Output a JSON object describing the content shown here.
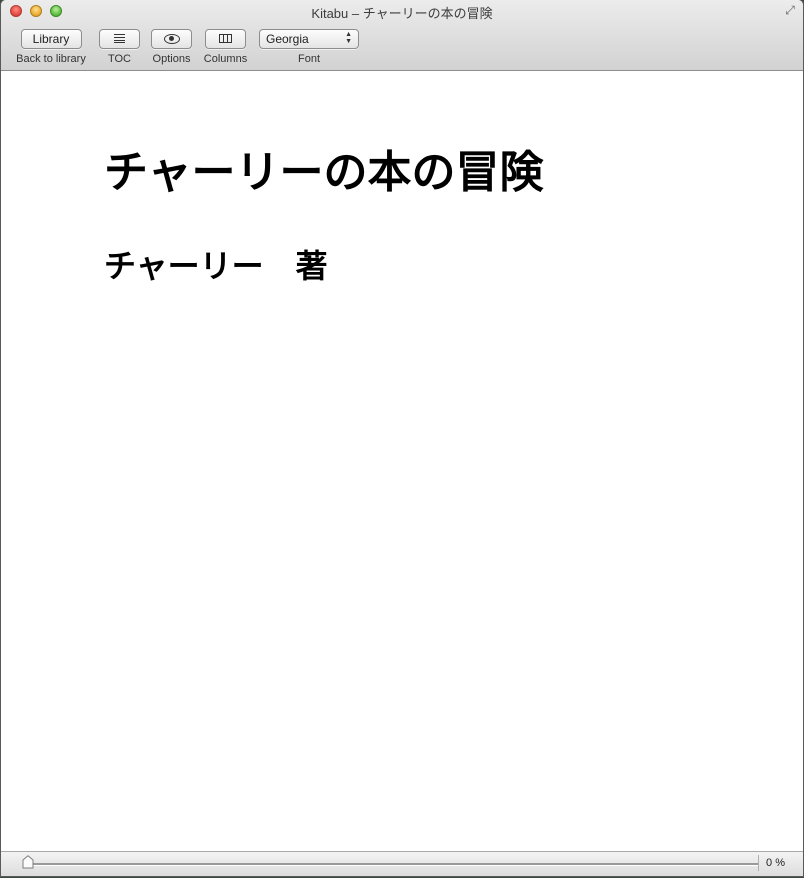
{
  "window": {
    "title": "Kitabu – チャーリーの本の冒険"
  },
  "toolbar": {
    "library_button": "Library",
    "library_label": "Back to library",
    "toc_label": "TOC",
    "options_label": "Options",
    "columns_label": "Columns",
    "font_value": "Georgia",
    "font_label": "Font",
    "icons": {
      "toc": "list-icon",
      "options": "eye-icon",
      "columns": "columns-icon",
      "fullscreen": "fullscreen-icon"
    }
  },
  "book": {
    "title": "チャーリーの本の冒険",
    "author": "チャーリー　著"
  },
  "status": {
    "progress_fraction": 0,
    "progress_text": "0 %"
  },
  "colors": {
    "toolbar_top": "#ececec",
    "toolbar_bottom": "#d2d2d2",
    "close": "#e0443b",
    "minimize": "#e8a72c",
    "maximize": "#57b83a"
  }
}
